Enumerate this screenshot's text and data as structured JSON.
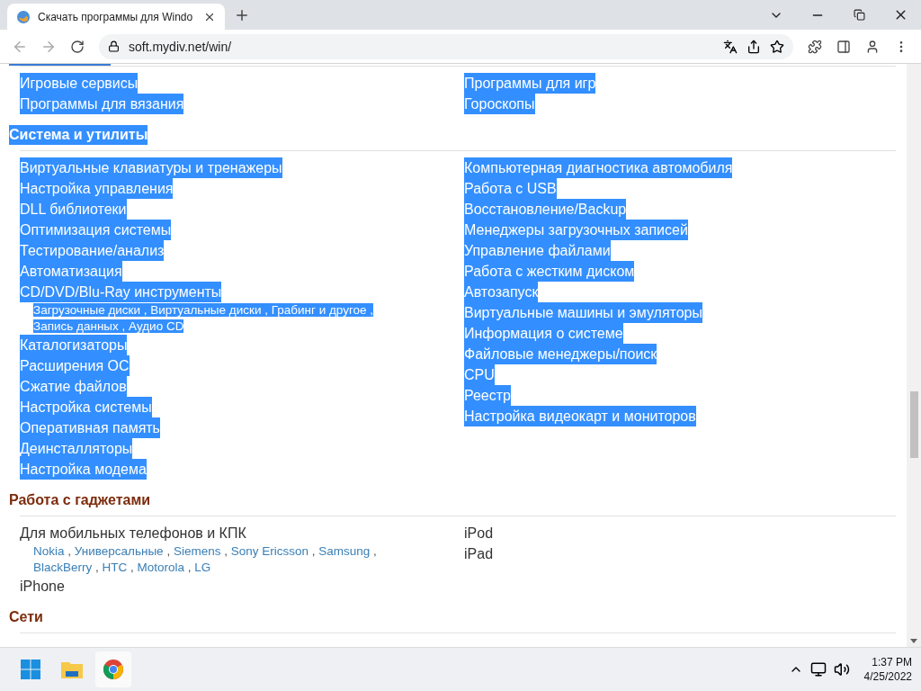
{
  "browser": {
    "tab_title": "Скачать программы для Windo",
    "address": "soft.mydiv.net/win/"
  },
  "sections": [
    {
      "left": [
        {
          "label": "Игровые сервисы",
          "selected": true
        },
        {
          "label": "Программы для вязания",
          "selected": true
        }
      ],
      "right": [
        {
          "label": "Программы для игр",
          "selected": true
        },
        {
          "label": "Гороскопы",
          "selected": true
        }
      ]
    },
    {
      "title": "Система и утилиты",
      "selected": true,
      "left": [
        {
          "label": "Виртуальные клавиатуры и тренажеры",
          "selected": true
        },
        {
          "label": "Настройка управления",
          "selected": true
        },
        {
          "label": "DLL библиотеки",
          "selected": true
        },
        {
          "label": "Оптимизация системы",
          "selected": true
        },
        {
          "label": "Тестирование/анализ",
          "selected": true
        },
        {
          "label": "Автоматизация",
          "selected": true
        },
        {
          "label": "CD/DVD/Blu-Ray инструменты",
          "selected": true,
          "separator": ",",
          "links": [
            "Загрузочные диски",
            "Виртуальные диски",
            "Грабинг и другое",
            "Запись данных",
            "Аудио CD"
          ]
        },
        {
          "label": "Каталогизаторы",
          "selected": true
        },
        {
          "label": "Расширения ОС",
          "selected": true
        },
        {
          "label": "Сжатие файлов",
          "selected": true
        },
        {
          "label": "Настройка системы",
          "selected": true
        },
        {
          "label": "Оперативная память",
          "selected": true
        },
        {
          "label": "Деинсталляторы",
          "selected": true
        },
        {
          "label": "Настройка модема",
          "selected": true
        }
      ],
      "right": [
        {
          "label": "Компьютерная диагностика автомобиля",
          "selected": true
        },
        {
          "label": "Работа с USB",
          "selected": true
        },
        {
          "label": "Восстановление/Backup",
          "selected": true
        },
        {
          "label": "Менеджеры загрузочных записей",
          "selected": true
        },
        {
          "label": "Управление файлами",
          "selected": true
        },
        {
          "label": "Работа с жестким диском",
          "selected": true
        },
        {
          "label": "Автозапуск",
          "selected": true
        },
        {
          "label": "Виртуальные машины и эмуляторы",
          "selected": true
        },
        {
          "label": "Информация о системе",
          "selected": true
        },
        {
          "label": "Файловые менеджеры/поиск",
          "selected": true
        },
        {
          "label": "CPU",
          "selected": true
        },
        {
          "label": "Реестр",
          "selected": true
        },
        {
          "label": "Настройка видеокарт и мониторов",
          "selected": true
        }
      ]
    },
    {
      "title": "Работа с гаджетами",
      "selected": false,
      "left": [
        {
          "label": "Для мобильных телефонов и КПК",
          "selected": false,
          "separator": ",",
          "links": [
            "Nokia",
            "Универсальные",
            "Siemens",
            "Sony Ericsson",
            "Samsung",
            "BlackBerry",
            "HTC",
            "Motorola",
            "LG"
          ]
        },
        {
          "label": "iPhone",
          "selected": false
        }
      ],
      "right": [
        {
          "label": "iPod",
          "selected": false
        },
        {
          "label": "iPad",
          "selected": false
        }
      ]
    },
    {
      "title": "Сети",
      "selected": false
    }
  ],
  "taskbar": {
    "time": "1:37 PM",
    "date": "4/25/2022"
  }
}
